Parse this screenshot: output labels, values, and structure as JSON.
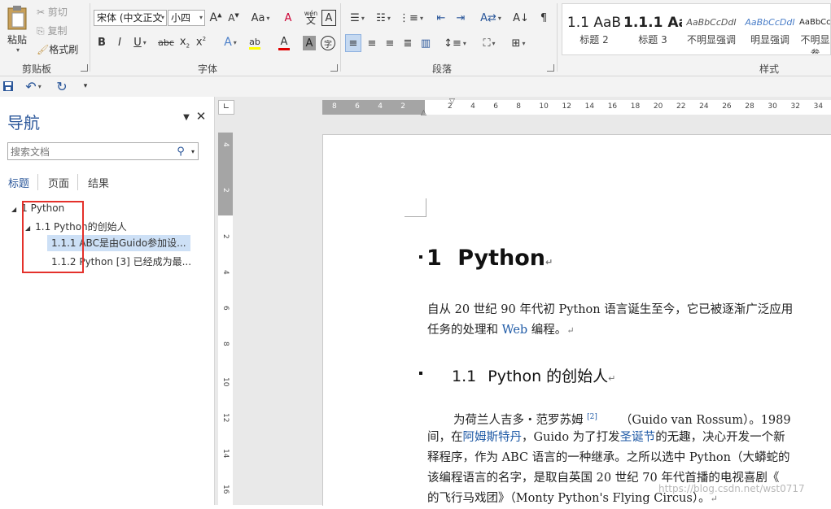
{
  "ribbon": {
    "clipboard": {
      "paste": "粘贴",
      "cut": "剪切",
      "copy": "复制",
      "format_painter": "格式刷",
      "group_label": "剪贴板"
    },
    "font": {
      "font_name": "宋体 (中文正文",
      "font_size": "小四",
      "pinyin_glyph": "wén",
      "group_label": "字体"
    },
    "paragraph": {
      "group_label": "段落"
    },
    "styles": {
      "group_label": "样式",
      "items": [
        {
          "sample": "1.1  AaB",
          "name": "标题 2"
        },
        {
          "sample": "1.1.1  Aa",
          "name": "标题 3"
        },
        {
          "sample": "AaBbCcDdI",
          "name": "不明显强调"
        },
        {
          "sample": "AaBbCcDdI",
          "name": "明显强调"
        },
        {
          "sample": "AaBbCcDdI",
          "name": "不明显参"
        }
      ]
    },
    "colors": {
      "accent": "#2b579a",
      "font_color_bar": "#e00000",
      "highlight_bar": "#ffff00"
    }
  },
  "nav": {
    "title": "导航",
    "search_placeholder": "搜索文档",
    "tabs": [
      "标题",
      "页面",
      "结果"
    ],
    "tree": [
      {
        "label": "1 Python",
        "level": 1
      },
      {
        "label": "1.1 Python的创始人",
        "level": 2
      },
      {
        "label": "1.1.1 ABC是由Guido参加设...",
        "level": 3,
        "selected": true
      },
      {
        "label": "1.1.2 Python [3]  已经成为最...",
        "level": 3
      }
    ]
  },
  "ruler": {
    "labels": [
      "8",
      "6",
      "4",
      "2",
      "2",
      "4",
      "6",
      "8",
      "10",
      "12",
      "14",
      "16",
      "18",
      "20",
      "22",
      "24",
      "26",
      "28",
      "30",
      "32",
      "34"
    ]
  },
  "vruler": {
    "labels": [
      "4",
      "2",
      "2",
      "4",
      "6",
      "8",
      "10",
      "12",
      "14",
      "16"
    ]
  },
  "document": {
    "h1_number": "1",
    "h1_text": "Python",
    "p1_line1": "自从 20 世纪 90 年代初 Python 语言诞生至今，它已被逐渐广泛应用",
    "p1_line2_a": "任务的处理和 ",
    "p1_line2_link": "Web",
    "p1_line2_b": " 编程。",
    "h2_number": "1.1",
    "h2_text": "Python 的创始人",
    "p2_line1_a": "为荷兰人吉多・范罗苏姆 ",
    "p2_ref": "[2]",
    "p2_line1_b": "（Guido van Rossum）。1989",
    "p2_line2_a": "间，在",
    "p2_line2_link1": "阿姆斯特丹",
    "p2_line2_b": "，Guido 为了打发",
    "p2_line2_link2": "圣诞节",
    "p2_line2_c": "的无趣，决心开发一个新",
    "p2_line3": "释程序，作为 ABC 语言的一种继承。之所以选中 Python（大蟒蛇的",
    "p2_line4": "该编程语言的名字，是取自英国 20 世纪 70 年代首播的电视喜剧《",
    "p2_line5": "的飞行马戏团》（Monty Python's Flying Circus）。",
    "watermark": "https://blog.csdn.net/wst0717"
  }
}
